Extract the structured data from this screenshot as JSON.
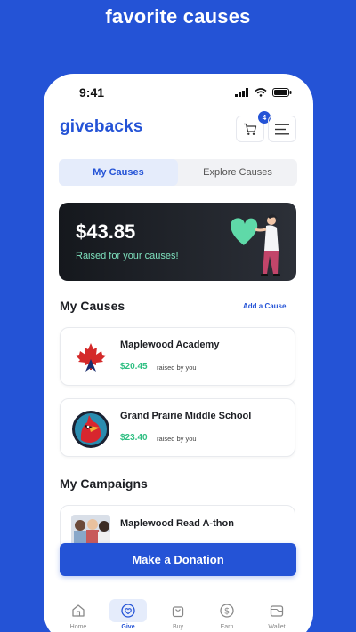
{
  "headline": "favorite causes",
  "status": {
    "time": "9:41"
  },
  "app": {
    "logo": "givebacks",
    "cart_count": "4"
  },
  "tabs": [
    {
      "label": "My Causes",
      "active": true
    },
    {
      "label": "Explore Causes",
      "active": false
    }
  ],
  "raised": {
    "amount": "$43.85",
    "label": "Raised for your causes!"
  },
  "my_causes": {
    "title": "My Causes",
    "add_label": "Add a Cause",
    "items": [
      {
        "name": "Maplewood Academy",
        "amount": "$20.45",
        "sub": "raised by you",
        "icon": "maple-leaf-icon"
      },
      {
        "name": "Grand Prairie Middle School",
        "amount": "$23.40",
        "sub": "raised by you",
        "icon": "cardinal-mascot-icon"
      }
    ]
  },
  "campaigns": {
    "title": "My Campaigns",
    "items": [
      {
        "name": "Maplewood Read A-thon"
      }
    ]
  },
  "donate_label": "Make a Donation",
  "nav": [
    {
      "label": "Home",
      "icon": "home-icon",
      "active": false
    },
    {
      "label": "Give",
      "icon": "heart-icon",
      "active": true
    },
    {
      "label": "Buy",
      "icon": "bag-icon",
      "active": false
    },
    {
      "label": "Earn",
      "icon": "dollar-icon",
      "active": false
    },
    {
      "label": "Wallet",
      "icon": "wallet-icon",
      "active": false
    }
  ],
  "colors": {
    "brand": "#2453d6",
    "accent_green": "#2fbf82",
    "card_dark": "#15181d"
  }
}
